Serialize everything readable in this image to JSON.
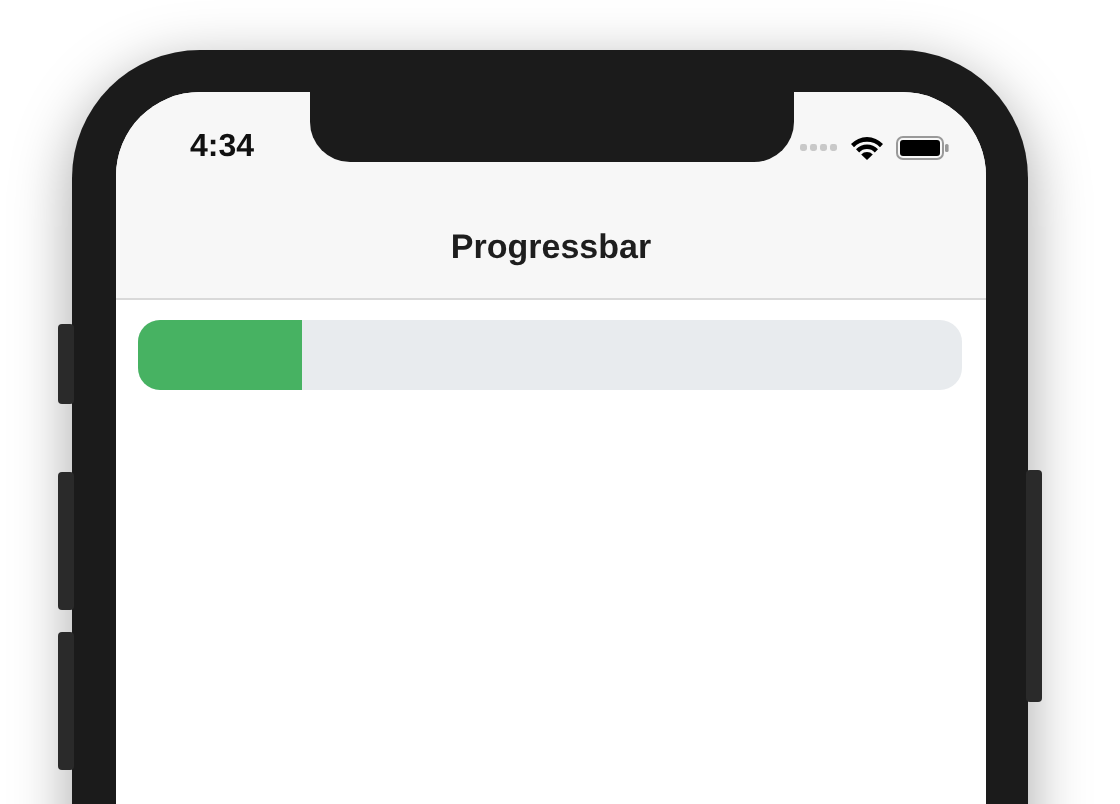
{
  "status_bar": {
    "time": "4:34"
  },
  "nav_bar": {
    "title": "Progressbar"
  },
  "progress": {
    "level": 0.2
  }
}
